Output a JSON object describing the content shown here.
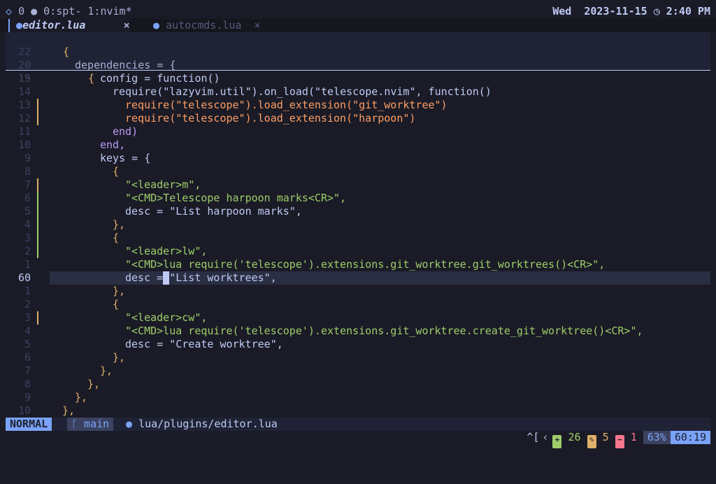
{
  "tmux": {
    "left": "0 ● 0:spt- 1:nvim*",
    "day": "Wed",
    "date": "2023-11-15",
    "time": "2:40 PM"
  },
  "tabs": [
    {
      "label": "editor.lua",
      "close": "×"
    },
    {
      "label": "autocmds.lua",
      "close": "×"
    }
  ],
  "context": [
    {
      "num": "22",
      "text": "{"
    },
    {
      "num": "20",
      "text": "dependencies = {"
    },
    {
      "num": "19",
      "text": "{"
    }
  ],
  "lines": [
    {
      "num": "15",
      "text": "config = function()"
    },
    {
      "num": "14",
      "text": "require(\"lazyvim.util\").on_load(\"telescope.nvim\", function()"
    },
    {
      "num": "13",
      "text": "require(\"telescope\").load_extension(\"git_worktree\")"
    },
    {
      "num": "12",
      "text": "require(\"telescope\").load_extension(\"harpoon\")"
    },
    {
      "num": "11",
      "text": "end)"
    },
    {
      "num": "10",
      "text": "end,"
    },
    {
      "num": "9",
      "text": "keys = {"
    },
    {
      "num": "8",
      "text": "{"
    },
    {
      "num": "7",
      "text": "\"<leader>m\","
    },
    {
      "num": "6",
      "text": "\"<CMD>Telescope harpoon marks<CR>\","
    },
    {
      "num": "5",
      "text": "desc = \"List harpoon marks\","
    },
    {
      "num": "4",
      "text": "},"
    },
    {
      "num": "3",
      "text": "{"
    },
    {
      "num": "2",
      "text": "\"<leader>lw\","
    },
    {
      "num": "1",
      "text": "\"<CMD>lua require('telescope').extensions.git_worktree.git_worktrees()<CR>\","
    },
    {
      "num": "60",
      "text": "desc = \"List worktrees\","
    },
    {
      "num": "1",
      "text": "},"
    },
    {
      "num": "2",
      "text": "{"
    },
    {
      "num": "3",
      "text": "\"<leader>cw\","
    },
    {
      "num": "4",
      "text": "\"<CMD>lua require('telescope').extensions.git_worktree.create_git_worktree()<CR>\","
    },
    {
      "num": "5",
      "text": "desc = \"Create worktree\","
    },
    {
      "num": "6",
      "text": "},"
    },
    {
      "num": "7",
      "text": "},"
    },
    {
      "num": "8",
      "text": "},"
    },
    {
      "num": "9",
      "text": "},"
    },
    {
      "num": "10",
      "text": "},"
    }
  ],
  "status": {
    "mode": "NORMAL",
    "branch": "main",
    "file": "lua/plugins/editor.lua",
    "keys": "^[",
    "added": "26",
    "modified": "5",
    "removed": "1",
    "percent": "63%",
    "position": "60:19"
  },
  "colors": {
    "background": "#1a1b26",
    "accent": "#7aa2f7",
    "added": "#9ece6a",
    "modified": "#e0af68",
    "removed": "#f7768e"
  }
}
